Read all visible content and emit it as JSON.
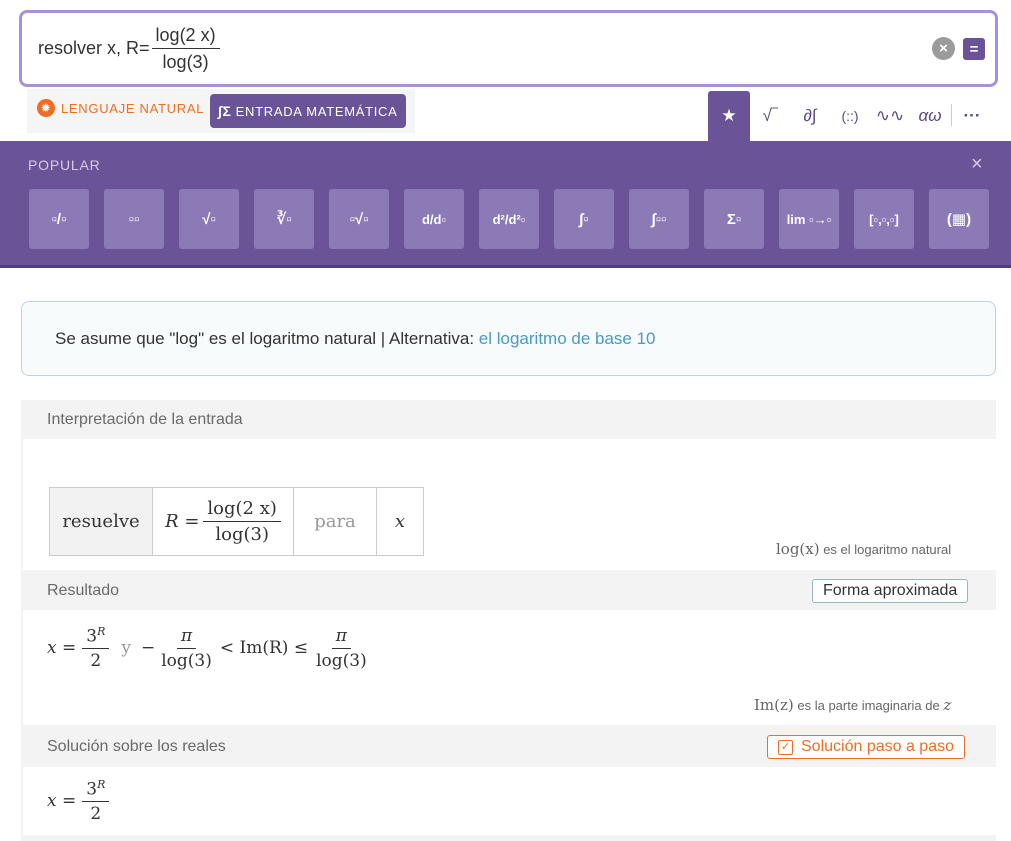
{
  "search": {
    "prefix": "resolver x, R=",
    "numerator": "log(2 x)",
    "denominator": "log(3)",
    "clear_glyph": "×",
    "submit_glyph": "="
  },
  "modes": {
    "natural_label": "LENGUAJE NATURAL",
    "math_label": "ENTRADA MATEMÁTICA",
    "natural_icon": "sun-icon",
    "math_icon": "integral-sum-icon"
  },
  "palette_tabs": [
    {
      "name": "favorites-tab",
      "glyph": "★"
    },
    {
      "name": "sqrt-tab",
      "glyph": "√‾"
    },
    {
      "name": "calculus-tab",
      "glyph": "∂∫"
    },
    {
      "name": "matrix-tab",
      "glyph": "(::)"
    },
    {
      "name": "waveform-tab",
      "glyph": "∿∿"
    },
    {
      "name": "greek-tab",
      "glyph": "αω"
    },
    {
      "name": "more-tab",
      "glyph": "···"
    }
  ],
  "palette": {
    "title": "POPULAR",
    "close_glyph": "×",
    "buttons": [
      {
        "name": "fraction-button",
        "glyph": "▫/▫"
      },
      {
        "name": "power-button",
        "glyph": "▫▫"
      },
      {
        "name": "sqrt-button",
        "glyph": "√▫"
      },
      {
        "name": "cube-root-button",
        "glyph": "∛▫"
      },
      {
        "name": "nth-root-button",
        "glyph": "▫√▫"
      },
      {
        "name": "derivative-button",
        "glyph": "d/d▫"
      },
      {
        "name": "second-derivative-button",
        "glyph": "d²/d²▫"
      },
      {
        "name": "integral-button",
        "glyph": "∫▫"
      },
      {
        "name": "definite-integral-button",
        "glyph": "∫▫▫"
      },
      {
        "name": "sum-button",
        "glyph": "Σ▫"
      },
      {
        "name": "limit-button",
        "glyph": "lim ▫→▫"
      },
      {
        "name": "list-button",
        "glyph": "[▫,▫,▫]"
      },
      {
        "name": "matrix-button",
        "glyph": "(▦)"
      }
    ]
  },
  "assumption": {
    "text": "Se asume que \"log\" es el logaritmo natural | Alternativa: ",
    "link": "el logaritmo de base 10"
  },
  "pods": {
    "input": {
      "title": "Interpretación de la entrada",
      "cells": [
        "resuelve",
        "R =",
        "log(2 x)",
        "log(3)",
        "para",
        "x"
      ],
      "note_math": "log(x)",
      "note_text": " es el logaritmo natural"
    },
    "result": {
      "title": "Resultado",
      "button": "Forma aproximada",
      "x_eq": "x =",
      "num": "3",
      "exp": "R",
      "den": "2",
      "and": "y",
      "minus": "−",
      "pi": "π",
      "log3": "log(3)",
      "lt": "< Im(R) ≤",
      "note_math": "Im(z)",
      "note_text": " es la parte imaginaria de ",
      "note_var": "z"
    },
    "real": {
      "title": "Solución sobre los reales",
      "button": "Solución paso a paso",
      "x_eq": "x =",
      "num": "3",
      "exp": "R",
      "den": "2"
    }
  }
}
